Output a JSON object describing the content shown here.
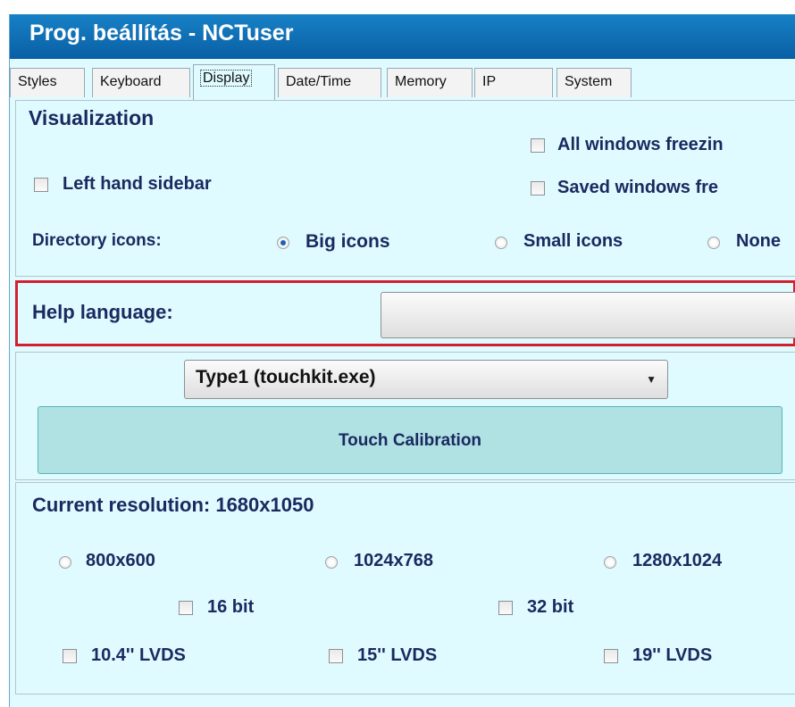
{
  "window": {
    "title": "Prog. beállítás - NCTuser"
  },
  "tabs": [
    "Styles",
    "Keyboard",
    "Display",
    "Date/Time",
    "Memory",
    "IP",
    "System"
  ],
  "active_tab": "Display",
  "visualization": {
    "heading": "Visualization",
    "all_windows_freezing": "All windows freezin",
    "left_hand_sidebar": "Left hand sidebar",
    "saved_windows_freezing": "Saved windows fre",
    "directory_icons_label": "Directory icons:",
    "big_icons": "Big icons",
    "small_icons": "Small icons",
    "none": "None",
    "selected_icon_option": "Big icons"
  },
  "help_language": {
    "label": "Help language:",
    "value": ""
  },
  "touch": {
    "driver_value": "Type1 (touchkit.exe)",
    "calibration_button": "Touch Calibration"
  },
  "resolution": {
    "current": "Current resolution: 1680x1050",
    "options": [
      "800x600",
      "1024x768",
      "1280x1024"
    ],
    "bit_16": "16 bit",
    "bit_32": "32 bit",
    "lvds_104": "10.4'' LVDS",
    "lvds_15": "15'' LVDS",
    "lvds_19": "19'' LVDS"
  },
  "colors": {
    "background": "#dffbff",
    "title_bar": "#1173bb",
    "highlight_border": "#d3202f"
  }
}
